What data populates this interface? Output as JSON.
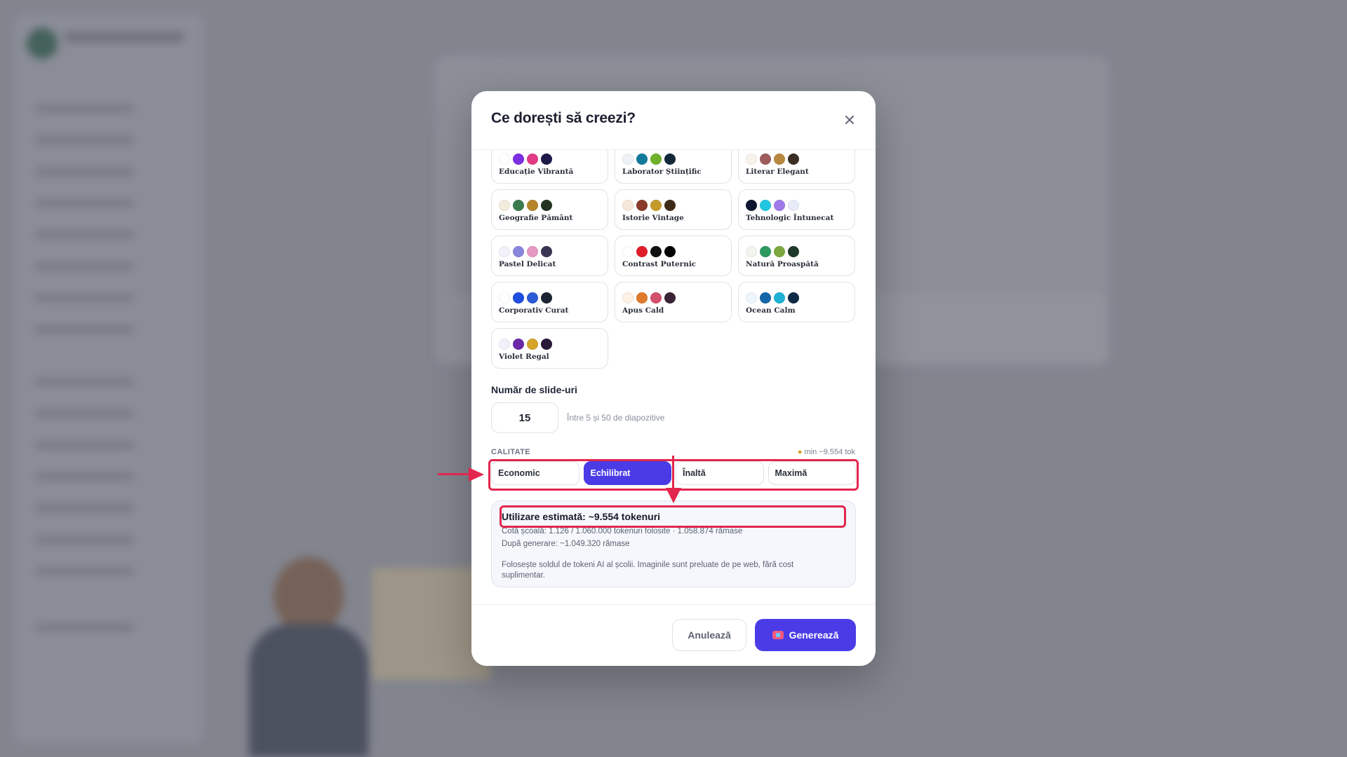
{
  "modal": {
    "title": "Ce dorești să creezi?",
    "close_icon": "close-icon"
  },
  "themes": [
    {
      "name": "Educație Vibrantă",
      "colors": [
        "#ffffff",
        "#7c2fe0",
        "#e23b86",
        "#1d1a4a"
      ]
    },
    {
      "name": "Laborator Științific",
      "colors": [
        "#eef2f6",
        "#137a9c",
        "#6fb22a",
        "#10283a"
      ]
    },
    {
      "name": "Literar Elegant",
      "colors": [
        "#f7f3ec",
        "#9e5c5c",
        "#b8873e",
        "#3b2c24"
      ]
    },
    {
      "name": "Geografie Pământ",
      "colors": [
        "#f3ecdd",
        "#3b7a4e",
        "#b5852a",
        "#243423"
      ]
    },
    {
      "name": "Istorie Vintage",
      "colors": [
        "#f6e8d8",
        "#8a3a2a",
        "#c69a2a",
        "#3e2a18"
      ]
    },
    {
      "name": "Tehnologic Întunecat",
      "colors": [
        "#0e1530",
        "#22c6e0",
        "#9f7ae8",
        "#e7ecf8"
      ]
    },
    {
      "name": "Pastel Delicat",
      "colors": [
        "#f4f1fa",
        "#8a86dc",
        "#e59ac1",
        "#3a3552"
      ]
    },
    {
      "name": "Contrast Puternic",
      "colors": [
        "#ffffff",
        "#e11d2b",
        "#111111",
        "#000000"
      ]
    },
    {
      "name": "Natură Proaspătă",
      "colors": [
        "#f2f6ee",
        "#2e9a5f",
        "#7ba83d",
        "#1f3a2a"
      ]
    },
    {
      "name": "Corporativ Curat",
      "colors": [
        "#ffffff",
        "#1e4fe0",
        "#2d5bd8",
        "#1c2433"
      ]
    },
    {
      "name": "Apus Cald",
      "colors": [
        "#fdf1e6",
        "#e07a2c",
        "#d2506e",
        "#3a2438"
      ]
    },
    {
      "name": "Ocean Calm",
      "colors": [
        "#eef5fb",
        "#1466a8",
        "#1fb2d4",
        "#0f2a44"
      ]
    },
    {
      "name": "Violet Regal",
      "colors": [
        "#f4f0fa",
        "#6a2aa8",
        "#d5a42a",
        "#2a1838"
      ]
    }
  ],
  "slides": {
    "label": "Număr de slide-uri",
    "value": "15",
    "hint": "Între 5 și 50 de diapozitive"
  },
  "quality": {
    "label": "CALITATE",
    "min_tokens": "min ~9.554 tok",
    "options": [
      "Economic",
      "Echilibrat",
      "Înaltă",
      "Maximă"
    ],
    "selected": "Echilibrat"
  },
  "usage": {
    "title": "Utilizare estimată: ~9.554 tokenuri",
    "quota_line": "Cotă școală: 1.126 / 1.060.000 tokenuri folosite · 1.058.874 rămase",
    "after_line": "După generare: ~1.049.320 rămase",
    "note": "Folosește soldul de tokeni AI al școlii. Imaginile sunt preluate de pe web, fără cost suplimentar."
  },
  "footer": {
    "cancel_label": "Anulează",
    "generate_label": "Generează"
  },
  "colors": {
    "accent": "#4a3be6",
    "annotation": "#e2264d"
  }
}
